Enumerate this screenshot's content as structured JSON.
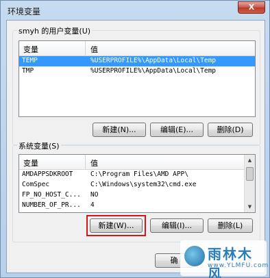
{
  "window": {
    "title": "环境变量",
    "close_glyph": "X"
  },
  "user_vars": {
    "label": "smyh 的用户变量(U)",
    "columns": [
      "变量",
      "值"
    ],
    "rows": [
      {
        "name": "TEMP",
        "value": "%USERPROFILE%\\AppData\\Local\\Temp",
        "selected": true
      },
      {
        "name": "TMP",
        "value": "%USERPROFILE%\\AppData\\Local\\Temp",
        "selected": false
      }
    ],
    "buttons": {
      "new": "新建(N)...",
      "edit": "编辑(E)...",
      "delete": "删除(D)"
    }
  },
  "system_vars": {
    "label": "系统变量(S)",
    "columns": [
      "变量",
      "值"
    ],
    "rows": [
      {
        "name": "AMDAPPSDKROOT",
        "value": "C:\\Program Files\\AMD APP\\"
      },
      {
        "name": "ComSpec",
        "value": "C:\\Windows\\system32\\cmd.exe"
      },
      {
        "name": "FP_NO_HOST_C...",
        "value": "NO"
      },
      {
        "name": "NUMBER_OF_PR...",
        "value": "4"
      }
    ],
    "buttons": {
      "new": "新建(W)...",
      "edit": "编辑(I)...",
      "delete": "删除(L)"
    }
  },
  "footer": {
    "ok_partial": "确"
  },
  "watermark": {
    "text": "雨林木风",
    "url": "www.YLMFU.com"
  },
  "colors": {
    "selection": "#3399ff",
    "highlight_box": "#d9121a"
  }
}
